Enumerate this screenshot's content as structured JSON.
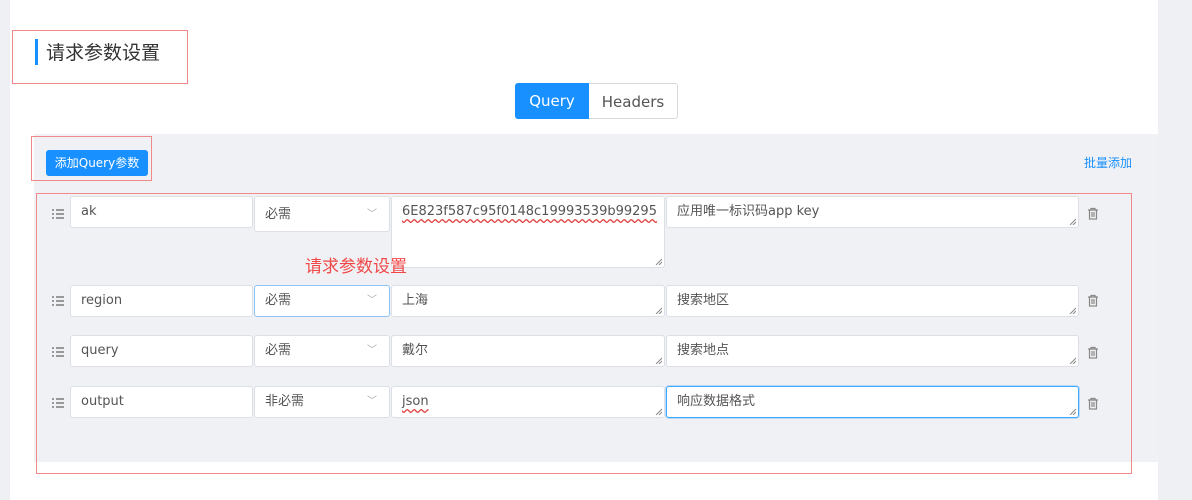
{
  "title": "请求参数设置",
  "tabs": [
    {
      "label": "Query",
      "active": true
    },
    {
      "label": "Headers",
      "active": false
    }
  ],
  "add_button": "添加Query参数",
  "batch_add": "批量添加",
  "annotation": "请求参数设置",
  "params": [
    {
      "name": "ak",
      "required": "必需",
      "value": "6E823f587c95f0148c19993539b99295",
      "description": "应用唯一标识码app key"
    },
    {
      "name": "region",
      "required": "必需",
      "value": "上海",
      "description": "搜索地区"
    },
    {
      "name": "query",
      "required": "必需",
      "value": "戴尔",
      "description": "搜索地点"
    },
    {
      "name": "output",
      "required": "非必需",
      "value": "json",
      "description": "响应数据格式"
    }
  ],
  "colors": {
    "accent": "#1890ff",
    "annotation": "#f04848"
  }
}
